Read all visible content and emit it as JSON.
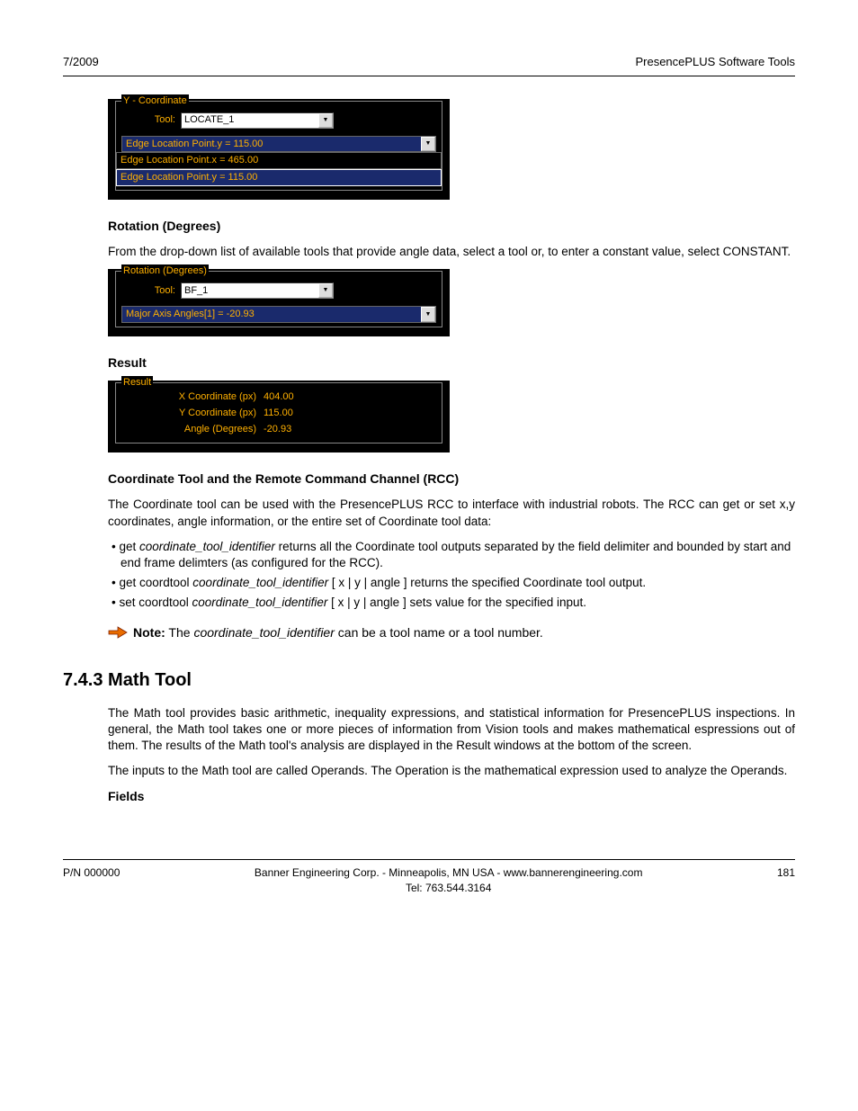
{
  "header": {
    "left": "7/2009",
    "right": "PresencePLUS Software Tools"
  },
  "panel_y": {
    "legend": "Y - Coordinate",
    "tool_label": "Tool:",
    "tool_value": "LOCATE_1",
    "selected": "Edge Location Point.y = 115.00",
    "lines": [
      "Edge Location Point.x = 465.00",
      "Edge Location Point.y = 115.00"
    ]
  },
  "rotation_heading": "Rotation (Degrees)",
  "rotation_text": "From the drop-down list of available tools that provide angle data, select a tool or, to enter a constant value, select CONSTANT.",
  "panel_rot": {
    "legend": "Rotation (Degrees)",
    "tool_label": "Tool:",
    "tool_value": "BF_1",
    "selected": "Major Axis Angles[1] = -20.93"
  },
  "result_heading": "Result",
  "panel_result": {
    "legend": "Result",
    "rows": [
      {
        "label": "X Coordinate (px)",
        "value": "404.00"
      },
      {
        "label": "Y Coordinate (px)",
        "value": "115.00"
      },
      {
        "label": "Angle (Degrees)",
        "value": "-20.93"
      }
    ]
  },
  "rcc": {
    "heading": "Coordinate Tool and the Remote Command Channel (RCC)",
    "intro": "The Coordinate tool can be used with the PresencePLUS RCC to interface with industrial robots. The RCC can get or set x,y coordinates, angle information, or the entire set of Coordinate tool data:",
    "b1a": "get ",
    "b1i": "coordinate_tool_identifier",
    "b1b": " returns all the Coordinate tool outputs separated by the field delimiter and bounded by start and end frame delimters (as configured for the RCC).",
    "b2a": "get coordtool ",
    "b2i": "coordinate_tool_identifier",
    "b2b": " [ x | y | angle ] returns the specified Coordinate tool output.",
    "b3a": "set coordtool ",
    "b3i": "coordinate_tool_identifier",
    "b3b": " [ x | y | angle ] sets value for the specified input.",
    "note_bold": "Note:",
    "note_a": "  The ",
    "note_i": "coordinate_tool_identifier",
    "note_b": " can be a tool name or a tool number."
  },
  "math": {
    "heading": "7.4.3 Math Tool",
    "p1": "The Math tool  provides basic arithmetic, inequality expressions, and statistical information for PresencePLUS inspections. In general, the Math tool takes one or more pieces of information from Vision tools and makes mathematical espressions out of them. The results of the Math tool's analysis are displayed in the Result windows at the bottom of the screen.",
    "p2": "The inputs to the Math tool are called Operands. The Operation is the mathematical expression used to analyze the Operands.",
    "fields_heading": "Fields"
  },
  "footer": {
    "left": "P/N 000000",
    "center1": "Banner Engineering Corp. - Minneapolis, MN USA - www.bannerengineering.com",
    "center2": "Tel: 763.544.3164",
    "right": "181"
  }
}
